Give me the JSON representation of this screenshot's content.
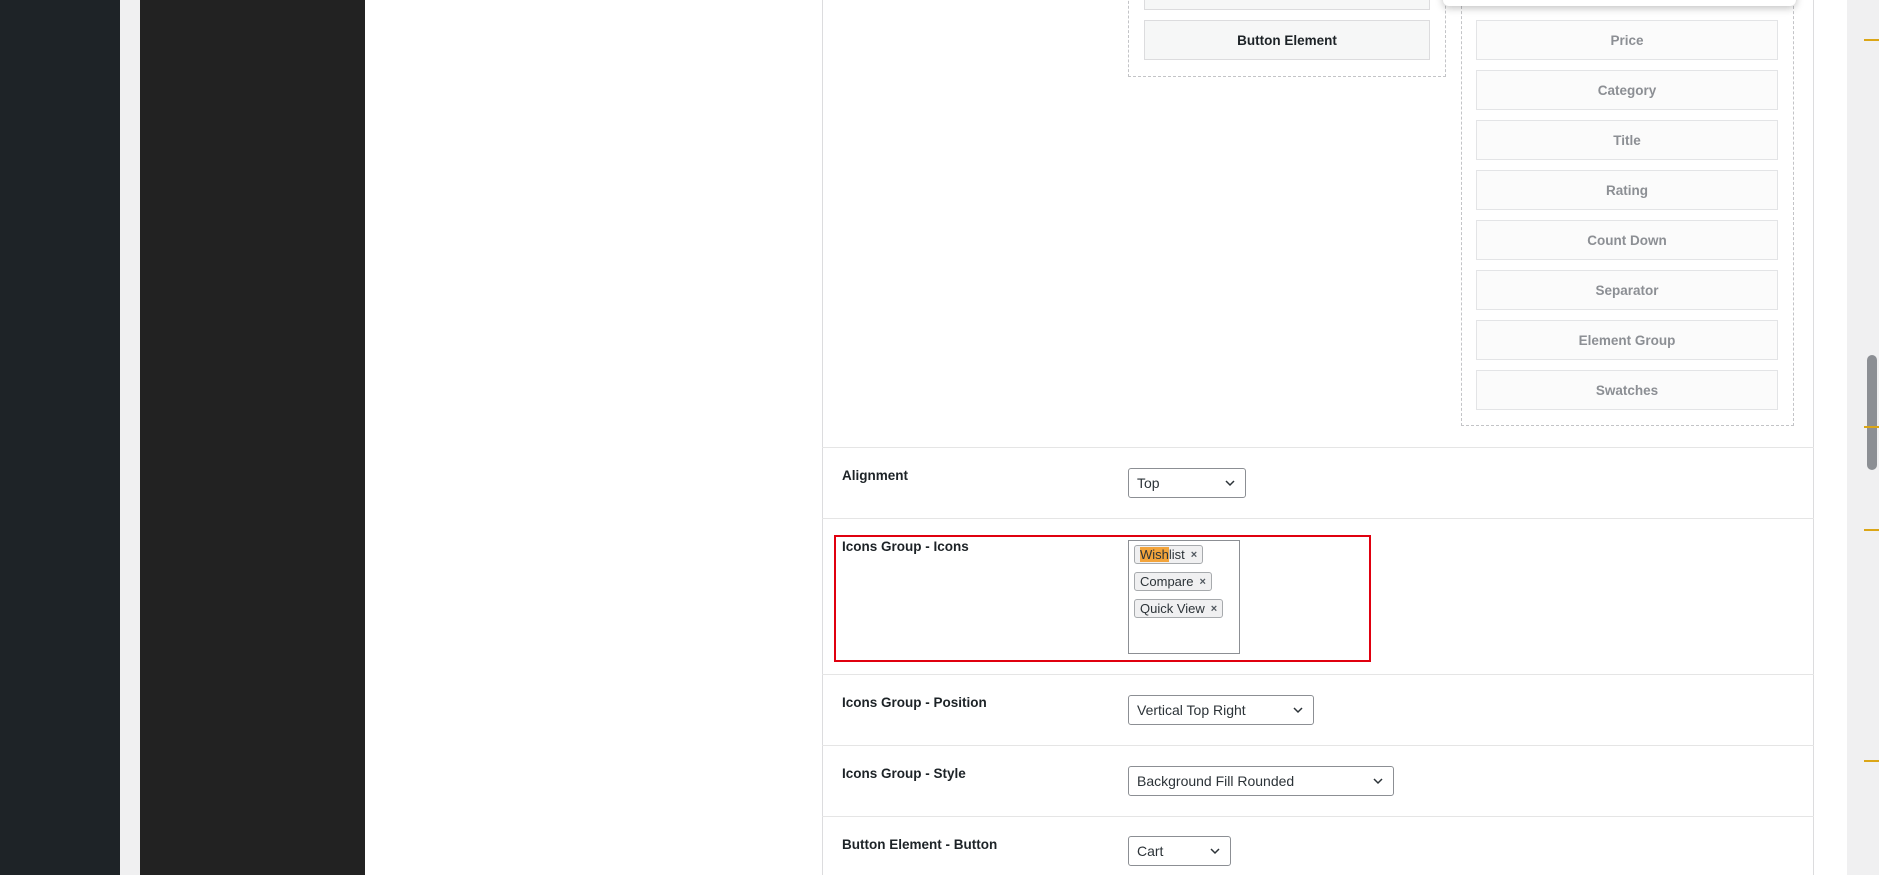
{
  "used_elements": {
    "items": [
      "Button Element"
    ]
  },
  "available_elements": {
    "items": [
      "Price",
      "Category",
      "Title",
      "Rating",
      "Count Down",
      "Separator",
      "Element Group",
      "Swatches"
    ]
  },
  "fields": {
    "alignment": {
      "label": "Alignment",
      "value": "Top"
    },
    "icons_group_icons": {
      "label": "Icons Group - Icons",
      "chips": [
        {
          "highlight": "Wish",
          "rest": "list",
          "remove": "×"
        },
        {
          "highlight": "",
          "rest": "Compare",
          "remove": "×"
        },
        {
          "highlight": "",
          "rest": "Quick View",
          "remove": "×"
        }
      ]
    },
    "icons_group_position": {
      "label": "Icons Group - Position",
      "value": "Vertical Top Right"
    },
    "icons_group_style": {
      "label": "Icons Group - Style",
      "value": "Background Fill Rounded"
    },
    "button_element_button": {
      "label": "Button Element - Button",
      "value": "Cart"
    }
  },
  "colors": {
    "highlight_box": "#e0000f",
    "search_highlight": "#f3a43b",
    "admin_dark": "#1e2327"
  },
  "icons": {
    "select_arrow": "chevron-down-icon",
    "chip_remove": "close-icon"
  }
}
